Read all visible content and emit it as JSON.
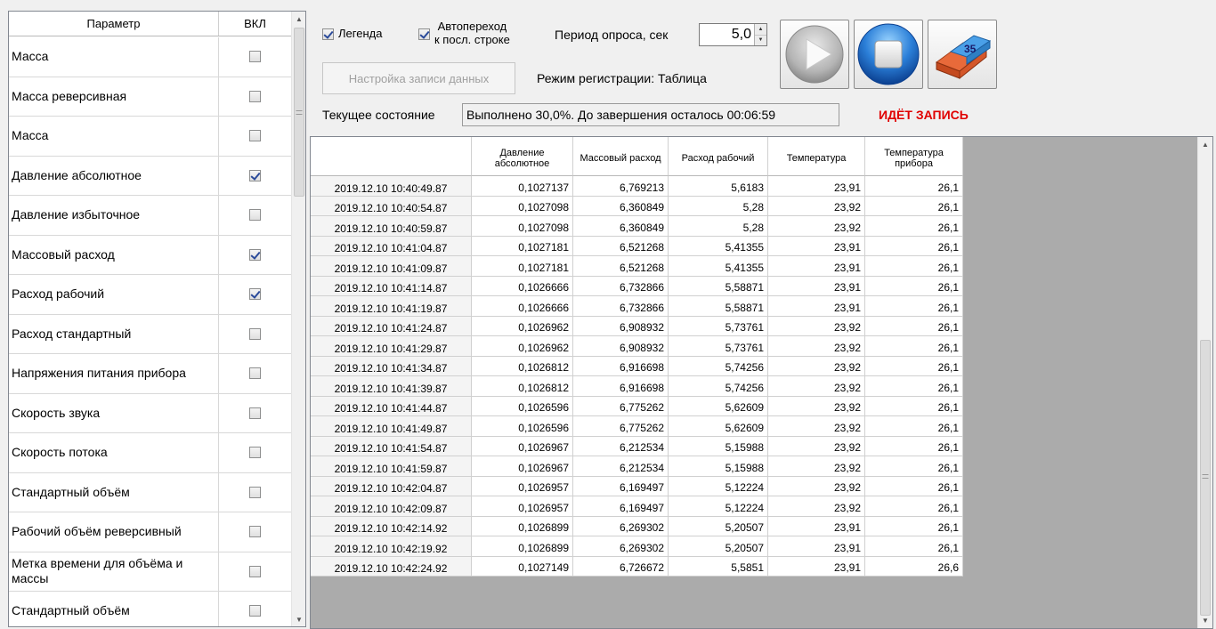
{
  "params_panel": {
    "header_name": "Параметр",
    "header_on": "ВКЛ",
    "items": [
      {
        "label": "Масса",
        "checked": false
      },
      {
        "label": "Масса реверсивная",
        "checked": false
      },
      {
        "label": "Масса",
        "checked": false
      },
      {
        "label": "Давление абсолютное",
        "checked": true
      },
      {
        "label": "Давление избыточное",
        "checked": false
      },
      {
        "label": "Массовый расход",
        "checked": true
      },
      {
        "label": "Расход рабочий",
        "checked": true
      },
      {
        "label": "Расход стандартный",
        "checked": false
      },
      {
        "label": "Напряжения питания прибора",
        "checked": false
      },
      {
        "label": "Скорость звука",
        "checked": false
      },
      {
        "label": "Скорость потока",
        "checked": false
      },
      {
        "label": "Стандартный объём",
        "checked": false
      },
      {
        "label": "Рабочий объём реверсивный",
        "checked": false
      },
      {
        "label": "Метка времени для объёма и массы",
        "checked": false
      },
      {
        "label": "Стандартный объём",
        "checked": false
      }
    ]
  },
  "controls": {
    "legend_label": "Легенда",
    "legend_checked": true,
    "autogo_line1": "Автопереход",
    "autogo_line2": "к посл. строке",
    "autogo_checked": true,
    "period_label": "Период опроса, сек",
    "period_value": "5,0",
    "rec_settings_label": "Настройка записи данных",
    "reg_mode": "Режим регистрации: Таблица",
    "state_label": "Текущее состояние",
    "state_value": "Выполнено 30,0%. До завершения осталось 00:06:59",
    "rec_status": "ИДЁТ ЗАПИСЬ",
    "eraser_badge": "35",
    "rec_status_color": "#e00000"
  },
  "table": {
    "columns": [
      "",
      "Давление абсолютное",
      "Массовый расход",
      "Расход рабочий",
      "Температура",
      "Температура прибора"
    ],
    "rows": [
      [
        "2019.12.10 10:40:49.87",
        "0,1027137",
        "6,769213",
        "5,6183",
        "23,91",
        "26,1"
      ],
      [
        "2019.12.10 10:40:54.87",
        "0,1027098",
        "6,360849",
        "5,28",
        "23,92",
        "26,1"
      ],
      [
        "2019.12.10 10:40:59.87",
        "0,1027098",
        "6,360849",
        "5,28",
        "23,92",
        "26,1"
      ],
      [
        "2019.12.10 10:41:04.87",
        "0,1027181",
        "6,521268",
        "5,41355",
        "23,91",
        "26,1"
      ],
      [
        "2019.12.10 10:41:09.87",
        "0,1027181",
        "6,521268",
        "5,41355",
        "23,91",
        "26,1"
      ],
      [
        "2019.12.10 10:41:14.87",
        "0,1026666",
        "6,732866",
        "5,58871",
        "23,91",
        "26,1"
      ],
      [
        "2019.12.10 10:41:19.87",
        "0,1026666",
        "6,732866",
        "5,58871",
        "23,91",
        "26,1"
      ],
      [
        "2019.12.10 10:41:24.87",
        "0,1026962",
        "6,908932",
        "5,73761",
        "23,92",
        "26,1"
      ],
      [
        "2019.12.10 10:41:29.87",
        "0,1026962",
        "6,908932",
        "5,73761",
        "23,92",
        "26,1"
      ],
      [
        "2019.12.10 10:41:34.87",
        "0,1026812",
        "6,916698",
        "5,74256",
        "23,92",
        "26,1"
      ],
      [
        "2019.12.10 10:41:39.87",
        "0,1026812",
        "6,916698",
        "5,74256",
        "23,92",
        "26,1"
      ],
      [
        "2019.12.10 10:41:44.87",
        "0,1026596",
        "6,775262",
        "5,62609",
        "23,92",
        "26,1"
      ],
      [
        "2019.12.10 10:41:49.87",
        "0,1026596",
        "6,775262",
        "5,62609",
        "23,92",
        "26,1"
      ],
      [
        "2019.12.10 10:41:54.87",
        "0,1026967",
        "6,212534",
        "5,15988",
        "23,92",
        "26,1"
      ],
      [
        "2019.12.10 10:41:59.87",
        "0,1026967",
        "6,212534",
        "5,15988",
        "23,92",
        "26,1"
      ],
      [
        "2019.12.10 10:42:04.87",
        "0,1026957",
        "6,169497",
        "5,12224",
        "23,92",
        "26,1"
      ],
      [
        "2019.12.10 10:42:09.87",
        "0,1026957",
        "6,169497",
        "5,12224",
        "23,92",
        "26,1"
      ],
      [
        "2019.12.10 10:42:14.92",
        "0,1026899",
        "6,269302",
        "5,20507",
        "23,91",
        "26,1"
      ],
      [
        "2019.12.10 10:42:19.92",
        "0,1026899",
        "6,269302",
        "5,20507",
        "23,91",
        "26,1"
      ],
      [
        "2019.12.10 10:42:24.92",
        "0,1027149",
        "6,726672",
        "5,5851",
        "23,91",
        "26,6"
      ]
    ]
  }
}
